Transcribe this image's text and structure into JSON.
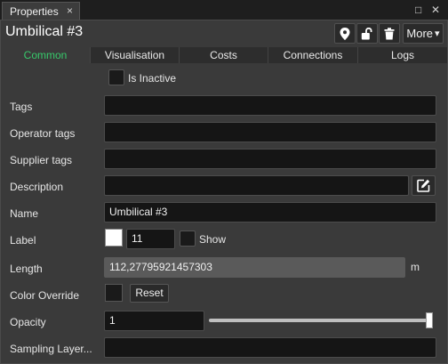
{
  "window": {
    "tab_title": "Properties",
    "tab_close_glyph": "×",
    "maximize_glyph": "□",
    "close_glyph": "✕"
  },
  "header": {
    "title": "Umbilical #3",
    "icons": [
      "map-pin-icon",
      "unlock-icon",
      "trash-icon"
    ],
    "more_label": "More",
    "more_caret": "▾"
  },
  "tabs": [
    {
      "label": "Common",
      "active": true
    },
    {
      "label": "Visualisation",
      "active": false
    },
    {
      "label": "Costs",
      "active": false
    },
    {
      "label": "Connections",
      "active": false
    },
    {
      "label": "Logs",
      "active": false
    }
  ],
  "accent_color": "#37c96b",
  "form": {
    "is_inactive_label": "Is Inactive",
    "tags_label": "Tags",
    "tags_value": "",
    "operator_tags_label": "Operator tags",
    "operator_tags_value": "",
    "supplier_tags_label": "Supplier tags",
    "supplier_tags_value": "",
    "description_label": "Description",
    "description_value": "",
    "description_edit_icon": "edit-icon",
    "name_label": "Name",
    "name_value": "Umbilical #3",
    "label_label": "Label",
    "label_color": "#ffffff",
    "label_size": "11",
    "show_label": "Show",
    "length_label": "Length",
    "length_value": "112,27795921457303",
    "length_unit": "m",
    "color_override_label": "Color Override",
    "reset_label": "Reset",
    "opacity_label": "Opacity",
    "opacity_value": "1",
    "opacity_slider_level": 1,
    "sampling_layer_label": "Sampling Layer...",
    "sampling_layer_value": ""
  }
}
